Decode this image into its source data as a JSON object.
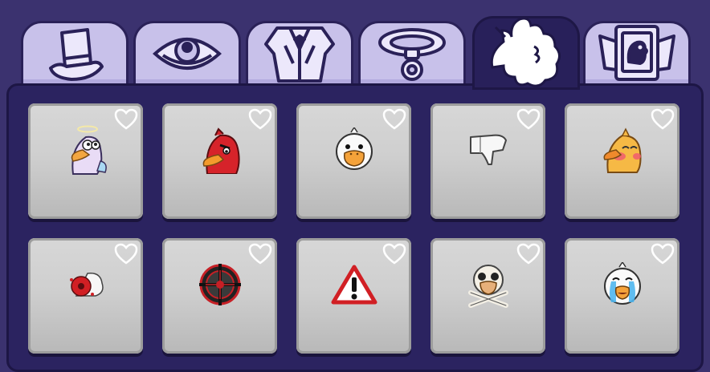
{
  "tabs": [
    {
      "name": "hats",
      "icon": "top-hat-icon",
      "active": false
    },
    {
      "name": "eyes",
      "icon": "eye-icon",
      "active": false
    },
    {
      "name": "outfits",
      "icon": "tuxedo-icon",
      "active": false
    },
    {
      "name": "collars",
      "icon": "collar-icon",
      "active": false
    },
    {
      "name": "emotes",
      "icon": "puff-cloud-icon",
      "active": true
    },
    {
      "name": "cards",
      "icon": "card-portrait-icon",
      "active": false
    }
  ],
  "emotes": [
    {
      "icon": "angel-duck-icon",
      "favorited": false
    },
    {
      "icon": "angry-red-duck-icon",
      "favorited": false
    },
    {
      "icon": "duck-face-icon",
      "favorited": false
    },
    {
      "icon": "thumbs-down-icon",
      "favorited": false
    },
    {
      "icon": "blushing-duck-icon",
      "favorited": false
    },
    {
      "icon": "blood-splat-icon",
      "favorited": false
    },
    {
      "icon": "crosshair-icon",
      "favorited": false
    },
    {
      "icon": "warning-sign-icon",
      "favorited": false
    },
    {
      "icon": "skull-crossbones-duck-icon",
      "favorited": false
    },
    {
      "icon": "crying-duck-icon",
      "favorited": false
    }
  ],
  "colors": {
    "background": "#3b326f",
    "tab": "#c8c1ea",
    "tab_active": "#28205a",
    "panel": "#2b2360",
    "card": "#cfcfcf"
  }
}
